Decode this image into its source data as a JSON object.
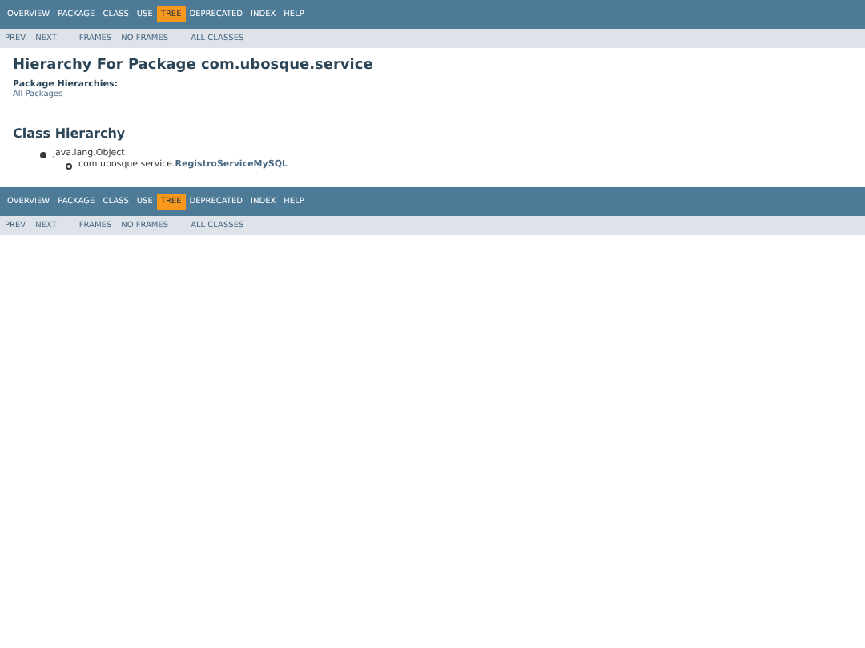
{
  "top_nav": {
    "items": [
      {
        "label": "OVERVIEW",
        "selected": false
      },
      {
        "label": "PACKAGE",
        "selected": false
      },
      {
        "label": "CLASS",
        "selected": false
      },
      {
        "label": "USE",
        "selected": false
      },
      {
        "label": "TREE",
        "selected": true
      },
      {
        "label": "DEPRECATED",
        "selected": false
      },
      {
        "label": "INDEX",
        "selected": false
      },
      {
        "label": "HELP",
        "selected": false
      }
    ],
    "sub_nav": [
      [
        "PREV",
        "NEXT"
      ],
      [
        "FRAMES",
        "NO FRAMES"
      ],
      [
        "ALL CLASSES"
      ]
    ]
  },
  "title": "Hierarchy For Package com.ubosque.service",
  "package_hierarchies": {
    "label": "Package Hierarchies:",
    "link": "All Packages"
  },
  "class_hierarchy": {
    "heading": "Class Hierarchy",
    "tree": [
      {
        "text": "java.lang.Object",
        "children": [
          {
            "text": "com.ubosque.service.**RegistroServiceMySQL**"
          }
        ]
      }
    ]
  },
  "bottom_nav": {
    "items": [
      {
        "label": "OVERVIEW",
        "selected": false
      },
      {
        "label": "PACKAGE",
        "selected": false
      },
      {
        "label": "CLASS",
        "selected": false
      },
      {
        "label": "USE",
        "selected": false
      },
      {
        "label": "TREE",
        "selected": true
      },
      {
        "label": "DEPRECATED",
        "selected": false
      },
      {
        "label": "INDEX",
        "selected": false
      },
      {
        "label": "HELP",
        "selected": false
      }
    ],
    "sub_nav": [
      [
        "PREV",
        "NEXT"
      ],
      [
        "FRAMES",
        "NO FRAMES"
      ],
      [
        "ALL CLASSES"
      ]
    ]
  }
}
